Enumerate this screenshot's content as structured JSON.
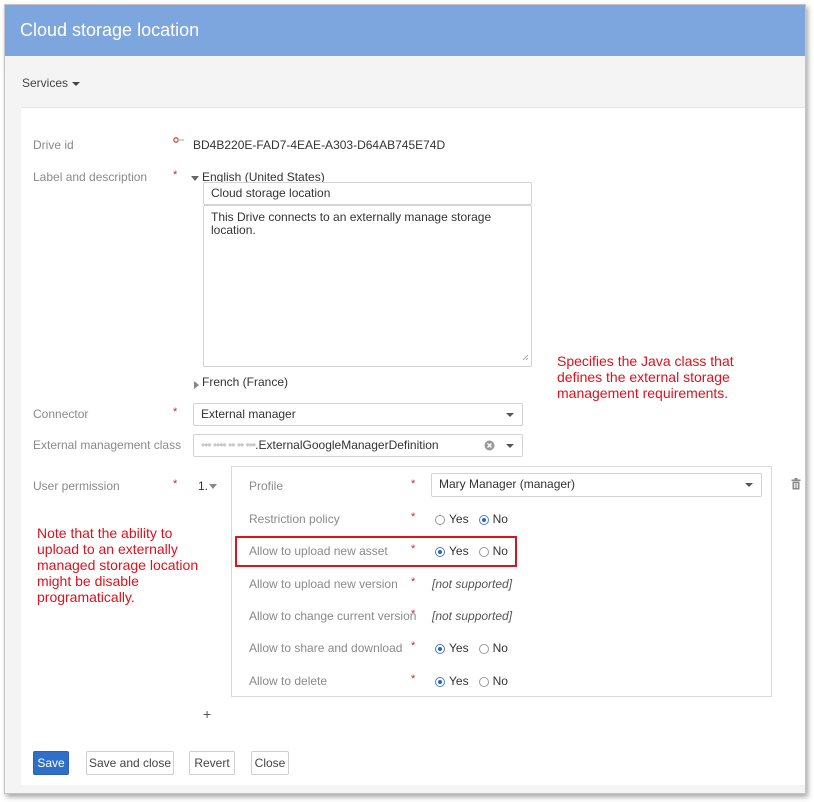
{
  "window": {
    "title": "Cloud storage location"
  },
  "toolbar": {
    "services_label": "Services"
  },
  "form": {
    "drive_id": {
      "label": "Drive id",
      "value": "BD4B220E-FAD7-4EAE-A303-D64AB745E74D"
    },
    "label_desc": {
      "label": "Label and description",
      "lang_primary": "English (United States)",
      "label_value": "Cloud storage location",
      "description_value": "This Drive connects to an externally manage storage location.",
      "lang_secondary": "French (France)"
    },
    "connector": {
      "label": "Connector",
      "value": "External manager"
    },
    "ext_class": {
      "label": "External management class",
      "value_blurred": "••• •••• •• •• •••",
      "value": ".ExternalGoogleManagerDefinition"
    },
    "user_permission": {
      "label": "User permission",
      "index": "1.",
      "profile": {
        "label": "Profile",
        "value": "Mary Manager (manager)"
      },
      "rows": [
        {
          "label": "Restriction policy",
          "type": "radio",
          "selected": "No"
        },
        {
          "label": "Allow to upload new asset",
          "type": "radio",
          "selected": "Yes"
        },
        {
          "label": "Allow to upload new version",
          "type": "text",
          "value": "[not supported]"
        },
        {
          "label": "Allow to change current version",
          "type": "text",
          "value": "[not supported]"
        },
        {
          "label": "Allow to share and download",
          "type": "radio",
          "selected": "Yes"
        },
        {
          "label": "Allow to delete",
          "type": "radio",
          "selected": "Yes"
        }
      ],
      "yes_label": "Yes",
      "no_label": "No",
      "add_symbol": "+"
    },
    "required_marker": "*"
  },
  "buttons": {
    "save": "Save",
    "save_close": "Save and close",
    "revert": "Revert",
    "close": "Close"
  },
  "annotations": {
    "class_note": "Specifies the Java class that defines the external storage management requirements.",
    "upload_note": "Note that the ability to upload to an externally managed storage location might be disable programatically."
  },
  "colors": {
    "titlebar": "#7ea6de",
    "primary_button": "#2f6fc9",
    "annotation": "#e0101a",
    "required": "#d0271d"
  }
}
